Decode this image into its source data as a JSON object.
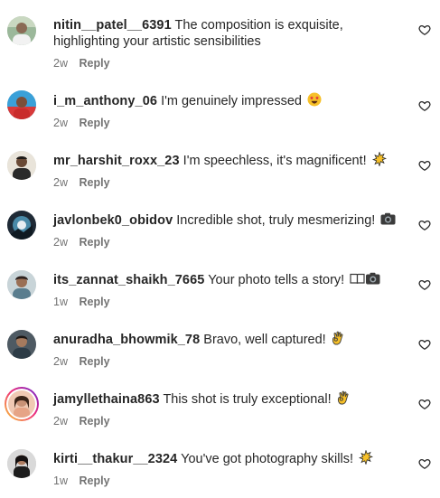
{
  "comments": [
    {
      "username": "nitin__patel__6391",
      "text": "The composition is exquisite, highlighting your artistic sensibilities",
      "time": "2w",
      "reply_label": "Reply",
      "avatar_icon": "avatar-photo-icon",
      "emoji_icon": ""
    },
    {
      "username": "i_m_anthony_06",
      "text": "I'm genuinely impressed",
      "time": "2w",
      "reply_label": "Reply",
      "avatar_icon": "avatar-photo-icon",
      "emoji_icon": "star-struck-emoji-icon"
    },
    {
      "username": "mr_harshit_roxx_23",
      "text": "I'm speechless, it's magnificent!",
      "time": "2w",
      "reply_label": "Reply",
      "avatar_icon": "avatar-photo-icon",
      "emoji_icon": "sparkle-burst-emoji-icon"
    },
    {
      "username": "javlonbek0_obidov",
      "text": "Incredible shot, truly mesmerizing!",
      "time": "2w",
      "reply_label": "Reply",
      "avatar_icon": "avatar-photo-icon",
      "emoji_icon": "camera-emoji-icon"
    },
    {
      "username": "its_zannat_shaikh_7665",
      "text": "Your photo tells a story!",
      "time": "1w",
      "reply_label": "Reply",
      "avatar_icon": "avatar-photo-icon",
      "emoji_icon": "book-and-camera-emoji-icon"
    },
    {
      "username": "anuradha_bhowmik_78",
      "text": "Bravo, well captured!",
      "time": "2w",
      "reply_label": "Reply",
      "avatar_icon": "avatar-photo-icon",
      "emoji_icon": "ok-hand-emoji-icon"
    },
    {
      "username": "jamyllethaina863",
      "text": "This shot is truly exceptional!",
      "time": "2w",
      "reply_label": "Reply",
      "avatar_icon": "avatar-story-ring-icon",
      "emoji_icon": "ok-hand-emoji-icon"
    },
    {
      "username": "kirti__thakur__2324",
      "text": "You've got photography skills!",
      "time": "1w",
      "reply_label": "Reply",
      "avatar_icon": "avatar-photo-icon",
      "emoji_icon": "sparkle-burst-emoji-icon"
    }
  ],
  "colors": {
    "username": "#262626",
    "meta": "#737373",
    "story_ring_start": "#f9ce34",
    "story_ring_end": "#6228d7",
    "heart_outline": "#262626"
  },
  "like_icon": "heart-outline-icon"
}
